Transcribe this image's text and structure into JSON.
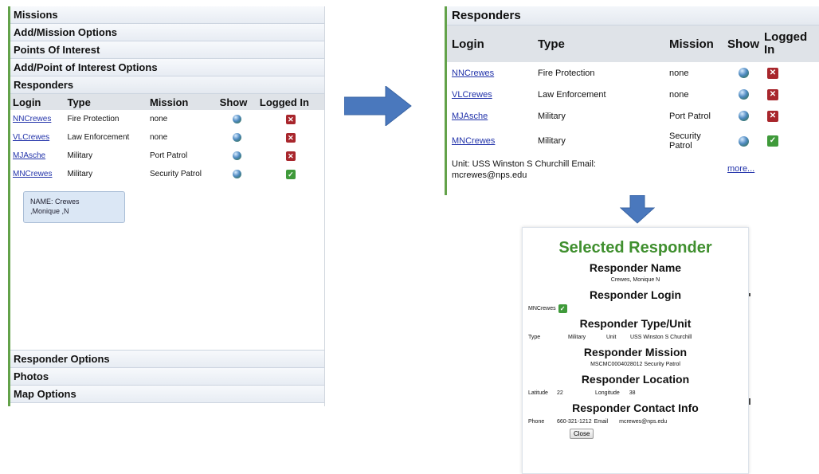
{
  "left_panel": {
    "headers": {
      "missions": "Missions",
      "add_mission_options": "Add/Mission Options",
      "points_of_interest": "Points Of Interest",
      "add_poi_options": "Add/Point of Interest Options",
      "responders": "Responders",
      "responder_options": "Responder Options",
      "photos": "Photos",
      "map_options": "Map Options"
    },
    "table": {
      "columns": [
        "Login",
        "Type",
        "Mission",
        "Show",
        "Logged In"
      ],
      "rows": [
        {
          "login": "NNCrewes",
          "type": "Fire Protection",
          "mission": "none",
          "logged_in": false
        },
        {
          "login": "VLCrewes",
          "type": "Law Enforcement",
          "mission": "none",
          "logged_in": false
        },
        {
          "login": "MJAsche",
          "type": "Military",
          "mission": "Port Patrol",
          "logged_in": false
        },
        {
          "login": "MNCrewes",
          "type": "Military",
          "mission": "Security Patrol",
          "logged_in": true
        }
      ]
    },
    "tooltip": {
      "line1": "NAME: Crewes",
      "line2": ",Monique ,N"
    }
  },
  "right_panel": {
    "title": "Responders",
    "columns": {
      "login": "Login",
      "type": "Type",
      "mission": "Mission",
      "show": "Show",
      "logged_1": "Logged",
      "logged_2": "In"
    },
    "rows": [
      {
        "login": "NNCrewes",
        "type": "Fire Protection",
        "mission": "none",
        "logged_in": false
      },
      {
        "login": "VLCrewes",
        "type": "Law Enforcement",
        "mission": "none",
        "logged_in": false
      },
      {
        "login": "MJAsche",
        "type": "Military",
        "mission": "Port Patrol",
        "logged_in": false
      },
      {
        "login": "MNCrewes",
        "type": "Military",
        "mission_1": "Security",
        "mission_2": "Patrol",
        "logged_in": true
      }
    ],
    "footer": {
      "line1": "Unit: USS Winston S Churchill Email:",
      "line2": "mcrewes@nps.edu",
      "more": "more..."
    }
  },
  "dialog": {
    "title": "Selected Responder",
    "name_heading": "Responder Name",
    "name_value": "Crewes, Monique N",
    "login_heading": "Responder Login",
    "login_value": "MNCrewes",
    "type_heading": "Responder Type/Unit",
    "type_label": "Type",
    "type_value": "Military",
    "unit_label": "Unit",
    "unit_value": "USS Winston S Churchill",
    "mission_heading": "Responder Mission",
    "mission_value": "MSCMC0004028012 Security Patrol",
    "location_heading": "Responder Location",
    "latitude_label": "Latitude",
    "latitude_value": "22",
    "longitude_label": "Longitude",
    "longitude_value": "38",
    "contact_heading": "Responder Contact Info",
    "phone_label": "Phone",
    "phone_value": "660-321-1212",
    "email_label": "Email",
    "email_value": "mcrewes@nps.edu",
    "close_label": "Close"
  },
  "icons": {
    "show": "globe-icon",
    "logged_out": "red-x-icon",
    "logged_in": "green-check-icon",
    "arrows": "blue-arrow-icon"
  },
  "colors": {
    "accent_green": "#63a24a",
    "title_green": "#3f8f2e",
    "arrow_blue": "#4a78bd",
    "logged_out_red": "#a8262c",
    "logged_in_green": "#3f9a3a"
  }
}
